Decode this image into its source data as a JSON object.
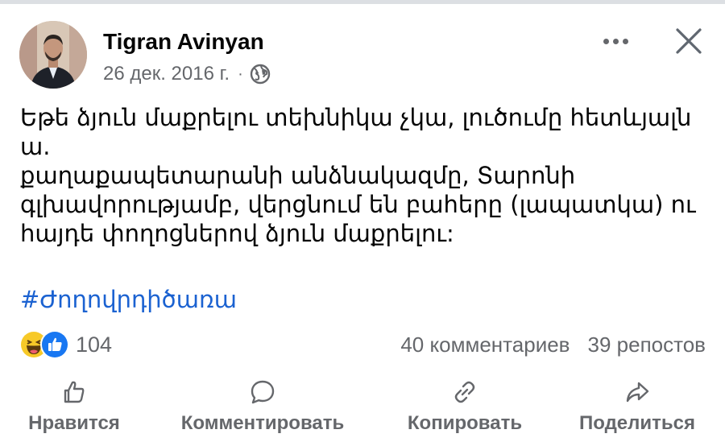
{
  "post": {
    "author": "Tigran Avinyan",
    "date": "26 дек. 2016 г.",
    "separator": "·",
    "text_lines": [
      "Եթե ձյուն մաքրելու տեխնիկա չկա, լուծումը հետևյալն",
      "ա.",
      "քաղաքապետարանի անձնակազմը, Տարոնի",
      "գլխավորությամբ, վերցնում են բահերը (լապատկա) ու",
      "հայդե փողոցներով ձյուն մաքրելու:"
    ],
    "hashtag": "#Ժողովրդիծառա"
  },
  "stats": {
    "reaction_count": "104",
    "comments": "40 комментариев",
    "shares": "39 репостов"
  },
  "actions": {
    "like": "Нравится",
    "comment": "Комментировать",
    "copy": "Копировать",
    "share": "Поделиться"
  },
  "icons": {
    "globe": "globe-icon",
    "more": "more-options-icon",
    "close": "close-icon",
    "like": "thumbs-up-icon",
    "comment": "comment-bubble-icon",
    "copy": "link-icon",
    "share": "share-arrow-icon"
  },
  "colors": {
    "link": "#1b62d1",
    "secondary_text": "#65676b",
    "like_blue": "#1877f2",
    "haha_yellow": "#f7c928"
  }
}
